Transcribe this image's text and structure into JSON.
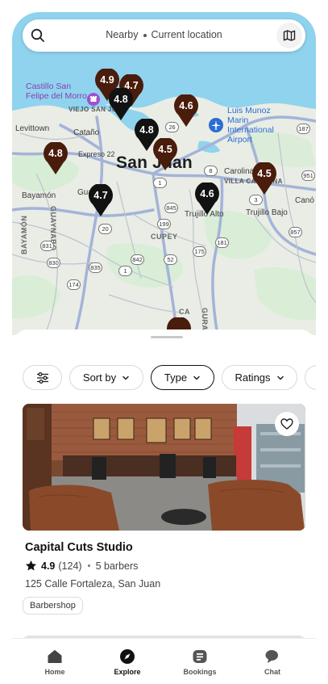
{
  "search": {
    "nearby": "Nearby",
    "location": "Current location"
  },
  "map": {
    "city_label": "San Juan",
    "labels": {
      "castillo": "Castillo San\nFelipe del Morro",
      "viejo": "VIEJO SAN JUAN",
      "levittown": "Levittown",
      "catano": "Cataño",
      "expreso": "Expreso 22",
      "bayamon": "Bayamón",
      "guaynabo": "GUAYNABO",
      "bayamon_v": "BAYAMÓN",
      "cupey": "CUPEY",
      "trujillo_alto": "Trujillo Alto",
      "trujillo_bajo": "Trujillo Bajo",
      "carolina": "Carolina",
      "villa_carolina": "VILLA CAROLINA",
      "airport": "Luis Munoz\nMarin\nInternational\nAirport",
      "cano": "Canó",
      "gura": "GURA",
      "ca": "CA",
      "gua": "Gua"
    },
    "road_shields": [
      "26",
      "187",
      "8",
      "951",
      "1",
      "3",
      "857",
      "845",
      "199",
      "181",
      "831",
      "20",
      "842",
      "52",
      "175",
      "830",
      "835",
      "174",
      "1"
    ],
    "pins": [
      "4.9",
      "4.7",
      "4.8",
      "4.6",
      "4.8",
      "4.5",
      "4.8",
      "4.7",
      "4.6",
      "4.5"
    ]
  },
  "filters": {
    "sort_by": "Sort by",
    "type": "Type",
    "ratings": "Ratings"
  },
  "listing": {
    "name": "Capital Cuts Studio",
    "rating": "4.9",
    "reviews": "(124)",
    "barbers": "5 barbers",
    "address": "125 Calle Fortaleza, San Juan",
    "tag": "Barbershop"
  },
  "tabs": {
    "home": "Home",
    "explore": "Explore",
    "bookings": "Bookings",
    "chat": "Chat"
  },
  "colors": {
    "pin_brown": "#4a1c0c",
    "pin_black": "#121212",
    "water": "#8fd3ee",
    "map_land": "#e9ede5"
  }
}
